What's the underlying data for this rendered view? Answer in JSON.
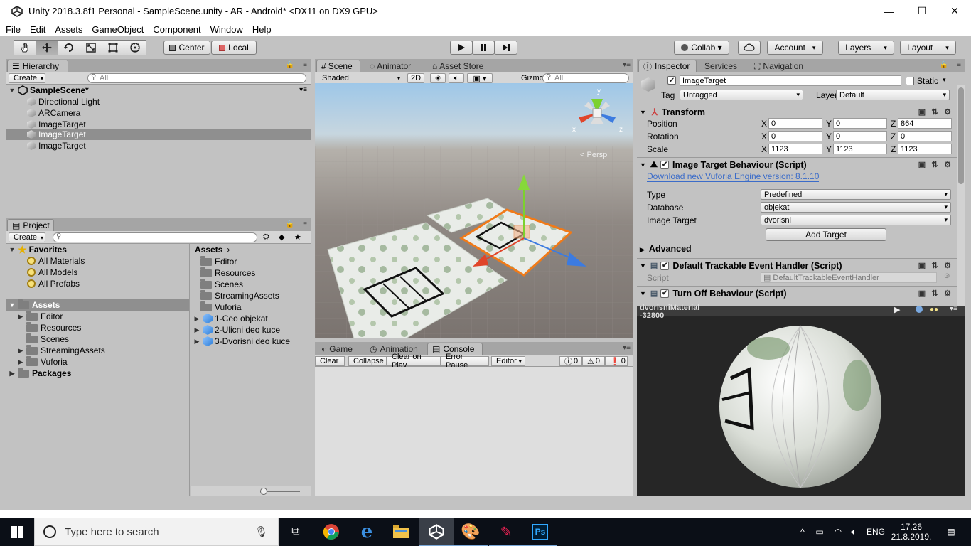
{
  "window": {
    "title": "Unity 2018.3.8f1 Personal - SampleScene.unity - AR - Android* <DX11 on DX9 GPU>",
    "controls": [
      "—",
      "☐",
      "✕"
    ]
  },
  "menu": [
    "File",
    "Edit",
    "Assets",
    "GameObject",
    "Component",
    "Window",
    "Help"
  ],
  "toolbar": {
    "pivot": "Center",
    "space": "Local",
    "collab": "Collab ▾",
    "account": "Account",
    "layers": "Layers",
    "layout": "Layout"
  },
  "hierarchy": {
    "tab": "Hierarchy",
    "create": "Create",
    "search_placeholder": "All",
    "scene": "SampleScene*",
    "items": [
      "Directional Light",
      "ARCamera",
      "ImageTarget",
      "ImageTarget",
      "ImageTarget"
    ],
    "selected_index": 3
  },
  "project": {
    "tab": "Project",
    "create": "Create",
    "favorites_label": "Favorites",
    "favorites": [
      "All Materials",
      "All Models",
      "All Prefabs"
    ],
    "assets_label": "Assets",
    "asset_folders": [
      "Editor",
      "Resources",
      "Scenes",
      "StreamingAssets",
      "Vuforia"
    ],
    "packages_label": "Packages",
    "breadcrumb": "Assets",
    "right_folders": [
      "Editor",
      "Resources",
      "Scenes",
      "StreamingAssets",
      "Vuforia"
    ],
    "right_prefabs": [
      "1-Ceo objekat",
      "2-Ulicni deo kuce",
      "3-Dvorisni deo kuce"
    ]
  },
  "scene": {
    "tabs": [
      "Scene",
      "Animator",
      "Asset Store"
    ],
    "shading": "Shaded",
    "mode_2d": "2D",
    "gizmos": "Gizmos",
    "search_placeholder": "All",
    "persp_label": "Persp",
    "axis_x": "x",
    "axis_y": "y",
    "axis_z": "z"
  },
  "console": {
    "tabs": [
      "Game",
      "Animation",
      "Console"
    ],
    "buttons": [
      "Clear",
      "Collapse",
      "Clear on Play",
      "Error Pause",
      "Editor"
    ],
    "counts": [
      "0",
      "0",
      "0"
    ]
  },
  "inspector": {
    "tabs": [
      "Inspector",
      "Services",
      "Navigation"
    ],
    "object_name": "ImageTarget",
    "static_label": "Static",
    "tag_label": "Tag",
    "tag_value": "Untagged",
    "layer_label": "Layer",
    "layer_value": "Default",
    "transform": {
      "title": "Transform",
      "rows": [
        {
          "label": "Position",
          "x": "0",
          "y": "0",
          "z": "864"
        },
        {
          "label": "Rotation",
          "x": "0",
          "y": "0",
          "z": "0"
        },
        {
          "label": "Scale",
          "x": "1123",
          "y": "1123",
          "z": "1123"
        }
      ]
    },
    "itb": {
      "title": "Image Target Behaviour (Script)",
      "link": "Download new Vuforia Engine version: 8.1.10",
      "type_label": "Type",
      "type_value": "Predefined",
      "db_label": "Database",
      "db_value": "objekat",
      "target_label": "Image Target",
      "target_value": "dvorisni",
      "add_target": "Add Target",
      "advanced": "Advanced"
    },
    "dteh": {
      "title": "Default Trackable Event Handler (Script)",
      "script_label": "Script",
      "script_value": "DefaultTrackableEventHandler"
    },
    "tob": {
      "title": "Turn Off Behaviour (Script)"
    },
    "preview": {
      "title": "dvorisniMaterial",
      "subtitle": "-32800"
    }
  },
  "taskbar": {
    "search_placeholder": "Type here to search",
    "lang": "ENG",
    "time": "17.26",
    "date": "21.8.2019."
  },
  "colors": {
    "selection": "#8f8f8f",
    "link": "#3b6cc9",
    "accent_orange": "#f07a18"
  }
}
